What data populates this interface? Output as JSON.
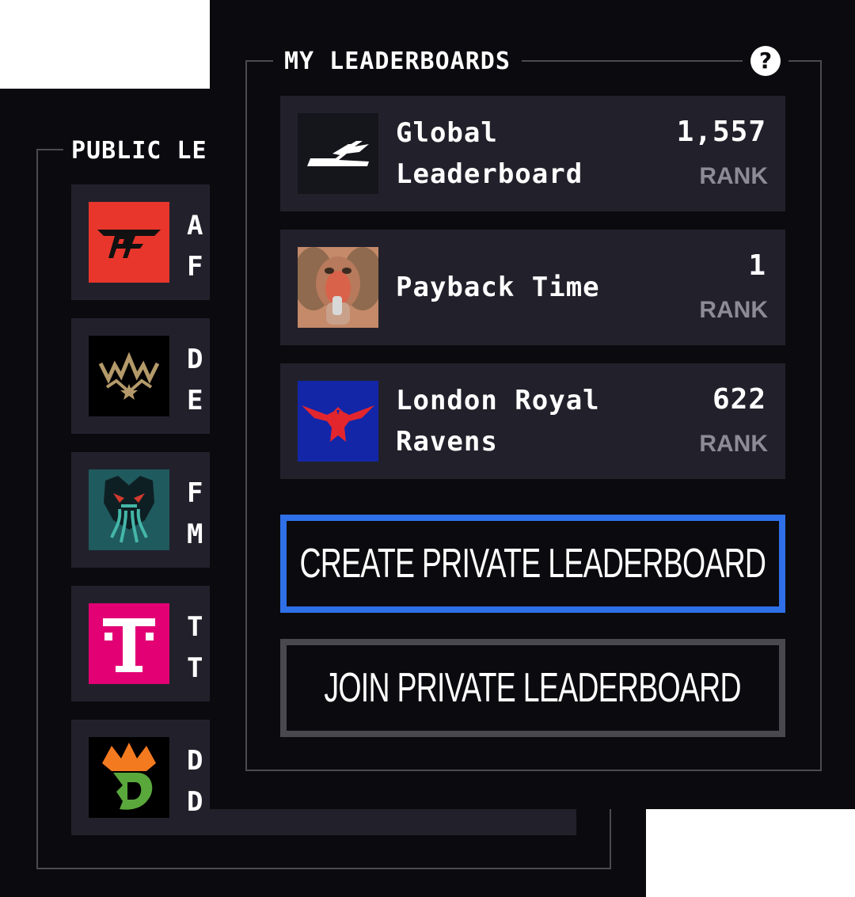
{
  "public_leaderboards": {
    "title": "PUBLIC LE",
    "items": [
      {
        "name_line1": "A",
        "name_line2": "F",
        "logo": "atlanta-faze-logo",
        "logo_bg": "#e8362c"
      },
      {
        "name_line1": "D",
        "name_line2": "E",
        "logo": "crown-logo",
        "logo_bg": "#000000"
      },
      {
        "name_line1": "F",
        "name_line2": "M",
        "logo": "kraken-logo",
        "logo_bg": "#1f5a5e"
      },
      {
        "name_line1": "T",
        "name_line2": "T",
        "logo": "telekom-t-logo",
        "logo_bg": "#e20074",
        "logo_text": "T"
      },
      {
        "name_line1": "D",
        "name_line2": "D",
        "logo": "draftkings-logo",
        "logo_bg": "#000000",
        "logo_text": "D"
      }
    ]
  },
  "my_leaderboards": {
    "title": "MY LEADERBOARDS",
    "help_icon": "help-icon",
    "help_glyph": "?",
    "items": [
      {
        "name_line1": "Global",
        "name_line2": "Leaderboard",
        "rank": "1,557",
        "rank_label": "RANK",
        "logo": "global-leaderboard-logo",
        "logo_bg": "#15151c"
      },
      {
        "name_line1": "Payback Time",
        "name_line2": "",
        "rank": "1",
        "rank_label": "RANK",
        "logo": "baboon-photo",
        "logo_bg": "#a8614a"
      },
      {
        "name_line1": "London Royal",
        "name_line2": "Ravens",
        "rank": "622",
        "rank_label": "RANK",
        "logo": "london-royal-ravens-logo",
        "logo_bg": "#1326a8"
      }
    ]
  },
  "buttons": {
    "create": "CREATE PRIVATE LEADERBOARD",
    "join": "JOIN PRIVATE LEADERBOARD"
  },
  "colors": {
    "panel_bg": "#0b0b0f",
    "card_bg": "#22212b",
    "create_border": "#2f6fe8",
    "join_border": "#48484e",
    "rank_label": "#8d8c96"
  }
}
